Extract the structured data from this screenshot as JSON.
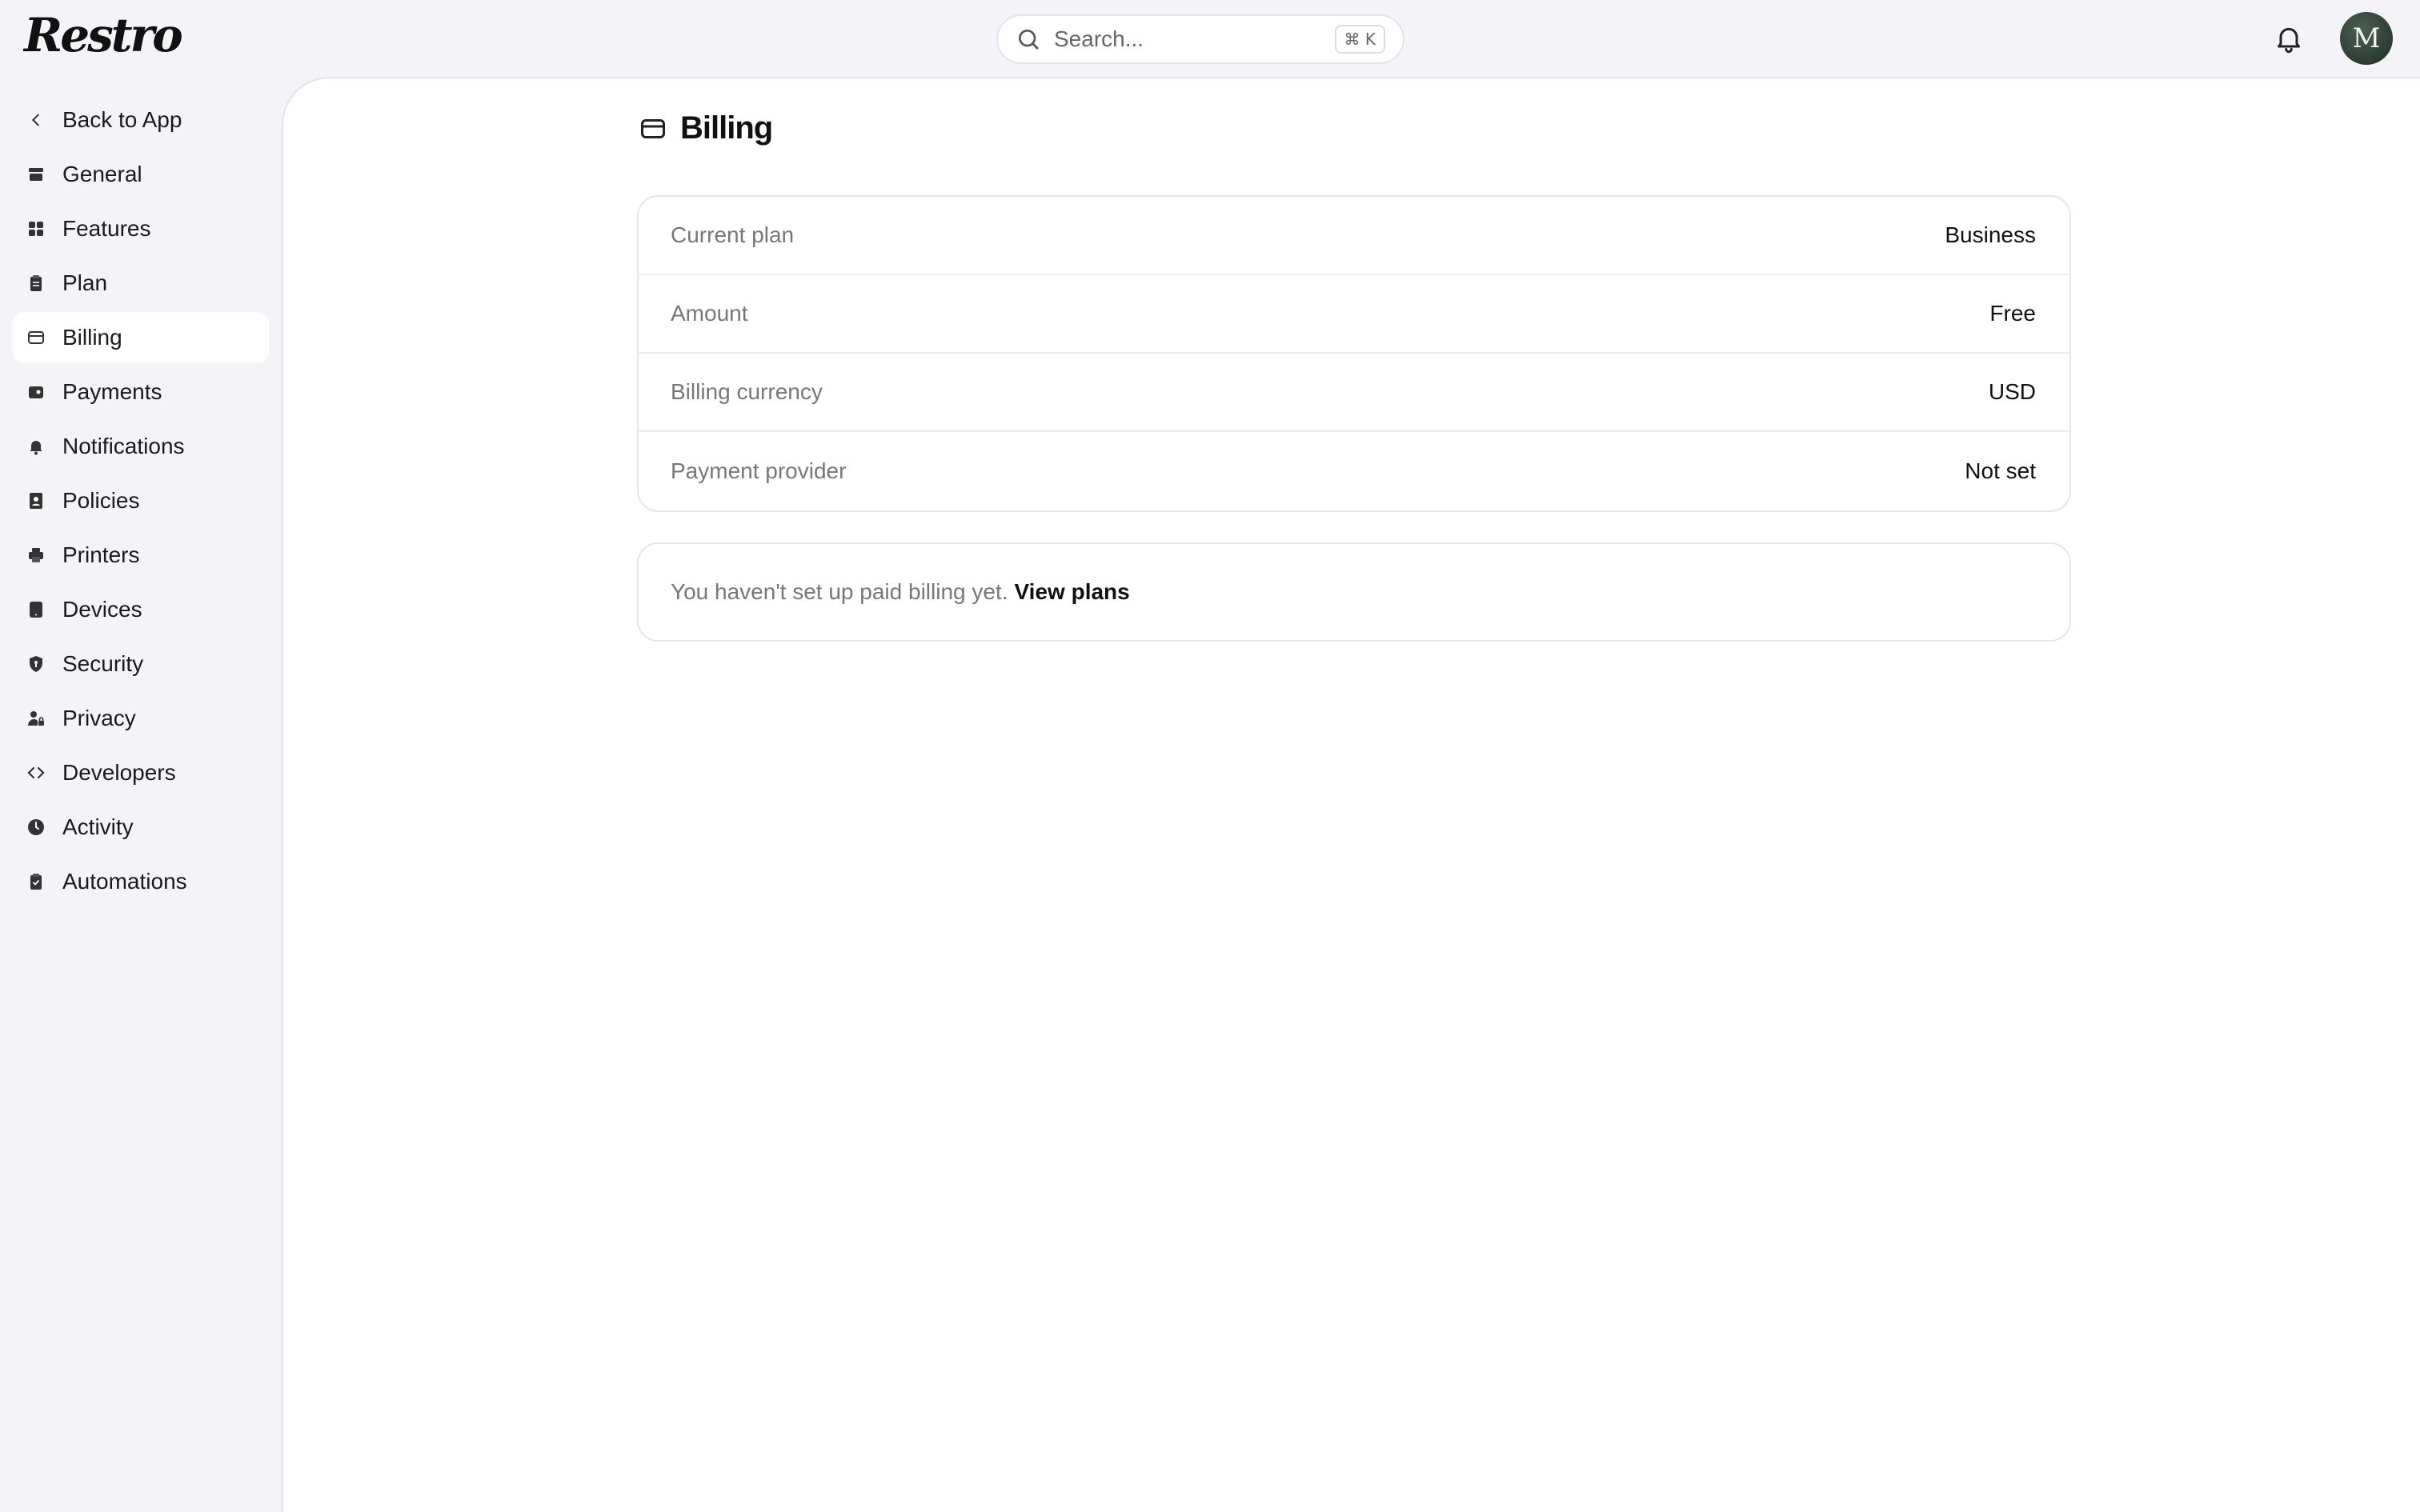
{
  "app": {
    "logo": "Restro"
  },
  "search": {
    "placeholder": "Search...",
    "shortcut": "⌘ K"
  },
  "user": {
    "avatar_initial": "M"
  },
  "sidebar": {
    "items": [
      {
        "label": "Back to App",
        "icon": "chevron-left-icon"
      },
      {
        "label": "General",
        "icon": "store-icon"
      },
      {
        "label": "Features",
        "icon": "grid-icon"
      },
      {
        "label": "Plan",
        "icon": "clipboard-icon"
      },
      {
        "label": "Billing",
        "icon": "credit-card-icon",
        "active": true
      },
      {
        "label": "Payments",
        "icon": "wallet-icon"
      },
      {
        "label": "Notifications",
        "icon": "bell-icon"
      },
      {
        "label": "Policies",
        "icon": "document-user-icon"
      },
      {
        "label": "Printers",
        "icon": "printer-icon"
      },
      {
        "label": "Devices",
        "icon": "tablet-icon"
      },
      {
        "label": "Security",
        "icon": "shield-icon"
      },
      {
        "label": "Privacy",
        "icon": "user-lock-icon"
      },
      {
        "label": "Developers",
        "icon": "code-icon"
      },
      {
        "label": "Activity",
        "icon": "clock-icon"
      },
      {
        "label": "Automations",
        "icon": "clipboard-check-icon"
      }
    ]
  },
  "page": {
    "title": "Billing",
    "icon": "credit-card-icon"
  },
  "billing": {
    "rows": [
      {
        "label": "Current plan",
        "value": "Business"
      },
      {
        "label": "Amount",
        "value": "Free"
      },
      {
        "label": "Billing currency",
        "value": "USD"
      },
      {
        "label": "Payment provider",
        "value": "Not set"
      }
    ],
    "notice": {
      "message": "You haven't set up paid billing yet.",
      "link": "View plans"
    }
  },
  "colors": {
    "background": "#f4f4f8",
    "panel": "#ffffff",
    "muted_text": "#777777",
    "text": "#111111"
  }
}
